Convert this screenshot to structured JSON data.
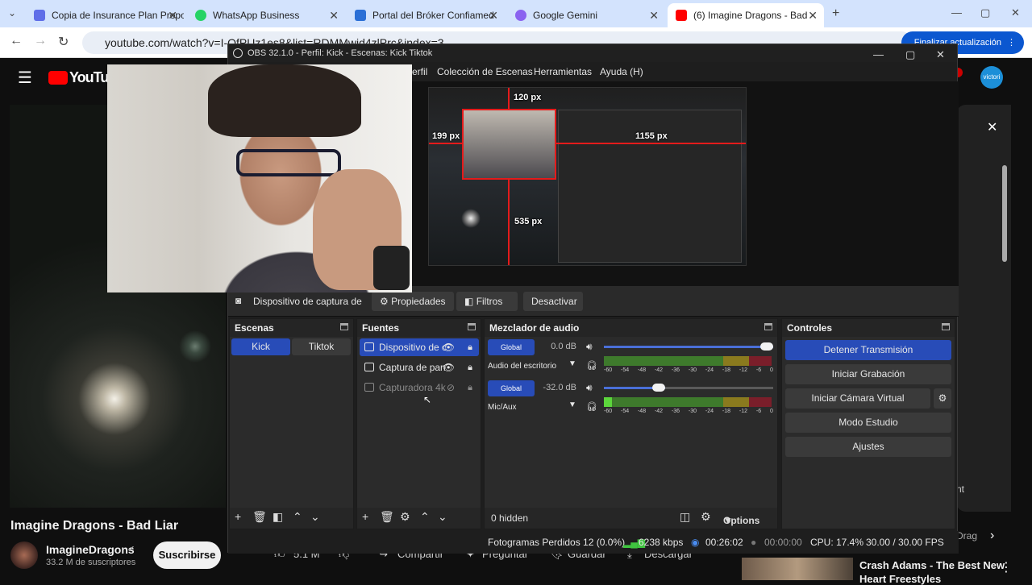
{
  "browser": {
    "tabs": [
      {
        "title": "Copia de Insurance Plan Propo",
        "color": "#5f6ee8"
      },
      {
        "title": "WhatsApp Business",
        "color": "#25d366"
      },
      {
        "title": "Portal del Bróker Confiamed",
        "color": "#2a6fd6"
      },
      {
        "title": "Google Gemini",
        "color": "#8a63f0"
      },
      {
        "title": "(6) Imagine Dragons - Bad",
        "color": "#ff0000"
      }
    ],
    "url": "youtube.com/watch?v=I-QfPUz1es8&list=RDMMwjd4zlPrc&index=3",
    "update_label": "Finalizar actualización",
    "profile_initial": "victori"
  },
  "youtube": {
    "logo": "YouTube",
    "video_title": "Imagine Dragons - Bad Liar",
    "channel": "ImagineDragons",
    "subscribers": "33.2 M de suscriptores",
    "subscribe_label": "Suscribirse",
    "likes": "5.1 M",
    "share": "Compartir",
    "ask": "Preguntar",
    "save": "Guardar",
    "download": "Descargar",
    "related_title": "Crash Adams - The Best New",
    "related_title_2": "Heart Freestyles",
    "side_text_1": "nt",
    "side_text_2": "Drag"
  },
  "obs": {
    "title": "OBS 32.1.0 - Perfil: Kick - Escenas: Kick Tiktok",
    "menu": [
      "erfil",
      "Colección de Escenas",
      "Herramientas",
      "Ayuda (H)"
    ],
    "preview_labels": {
      "top": "120 px",
      "left": "199 px",
      "right": "1155 px",
      "bottom": "535 px"
    },
    "source_bar": {
      "current_source": "Dispositivo de captura de v",
      "properties": "Propiedades",
      "filters": "Filtros",
      "deactivate": "Desactivar"
    },
    "scenes": {
      "title": "Escenas",
      "items": [
        {
          "name": "Kick",
          "selected": true
        },
        {
          "name": "Tiktok",
          "selected": false
        }
      ]
    },
    "sources": {
      "title": "Fuentes",
      "items": [
        {
          "name": "Dispositivo de c",
          "selected": true,
          "visible": true
        },
        {
          "name": "Captura de pan",
          "selected": false,
          "visible": true
        },
        {
          "name": "Capturadora 4k",
          "selected": false,
          "visible": false
        }
      ]
    },
    "mixer": {
      "title": "Mezclador de audio",
      "channels": [
        {
          "badge": "Global",
          "db": "0.0 dB",
          "name": "Audio del escritorio",
          "volume": 1.0,
          "level": 0.0
        },
        {
          "badge": "Global",
          "db": "-32.0 dB",
          "name": "Mic/Aux",
          "volume": 0.36,
          "level": 0.05
        }
      ],
      "scale": [
        "-60",
        "-54",
        "-48",
        "-42",
        "-36",
        "-30",
        "-24",
        "-18",
        "-12",
        "-6",
        "0"
      ],
      "hidden": "0 hidden",
      "options": "Options"
    },
    "controls": {
      "title": "Controles",
      "stop_stream": "Detener Transmisión",
      "start_recording": "Iniciar Grabación",
      "start_virtual_cam": "Iniciar Cámara Virtual",
      "studio_mode": "Modo Estudio",
      "settings": "Ajustes"
    },
    "status": {
      "dropped_frames": "Fotogramas Perdidos 12 (0.0%)",
      "bitrate": "6238 kbps",
      "stream_time": "00:26:02",
      "rec_time": "00:00:00",
      "cpu": "CPU: 17.4%",
      "fps": "30.00 / 30.00 FPS"
    }
  }
}
